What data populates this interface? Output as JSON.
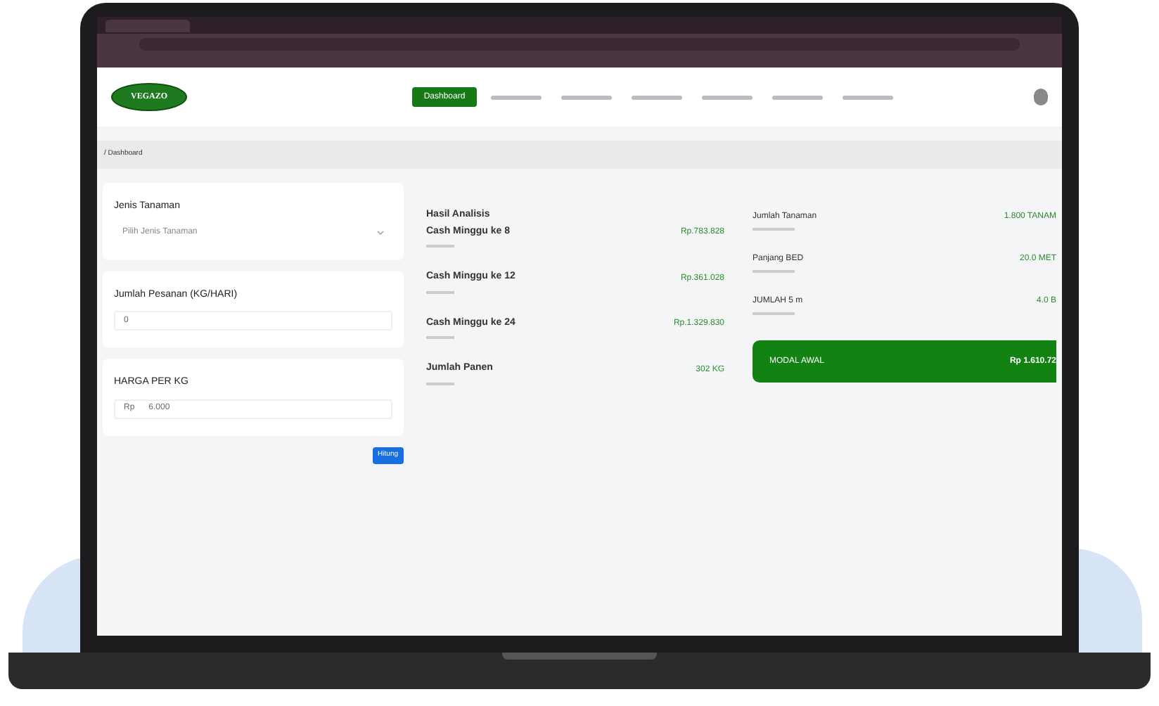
{
  "app": {
    "logo": "VEGAZO",
    "nav": [
      {
        "label": "Dashboard",
        "selected": true
      }
    ],
    "breadcrumb": "/ Dashboard"
  },
  "form": {
    "fields": [
      {
        "label": "Jenis Tanaman",
        "kind": "select",
        "placeholder": "Pilih Jenis Tanaman"
      },
      {
        "label": "Jumlah Pesanan (KG/HARI)",
        "kind": "input",
        "value": "0"
      },
      {
        "label": "HARGA PER KG",
        "kind": "prefixed",
        "prefix": "Rp",
        "value": "6.000"
      }
    ],
    "button": "Hitung"
  },
  "analysis": {
    "title": "Hasil Analisis",
    "rows": [
      {
        "label": "Cash Minggu ke 8",
        "value": "Rp.783.828"
      },
      {
        "label": "Cash Minggu ke 12",
        "value": "Rp.361.028"
      },
      {
        "label": "Cash Minggu ke 24",
        "value": "Rp.1.329.830"
      },
      {
        "label": "Jumlah Panen",
        "value": "302 KG"
      }
    ]
  },
  "summary": {
    "rows": [
      {
        "label": "Jumlah Tanaman",
        "value": "1.800 TANAM"
      },
      {
        "label": "Panjang BED",
        "value": "20.0 MET"
      },
      {
        "label": "JUMLAH 5 m",
        "value": "4.0 B"
      }
    ],
    "total": {
      "label": "MODAL AWAL",
      "value": "Rp 1.610.72"
    }
  }
}
